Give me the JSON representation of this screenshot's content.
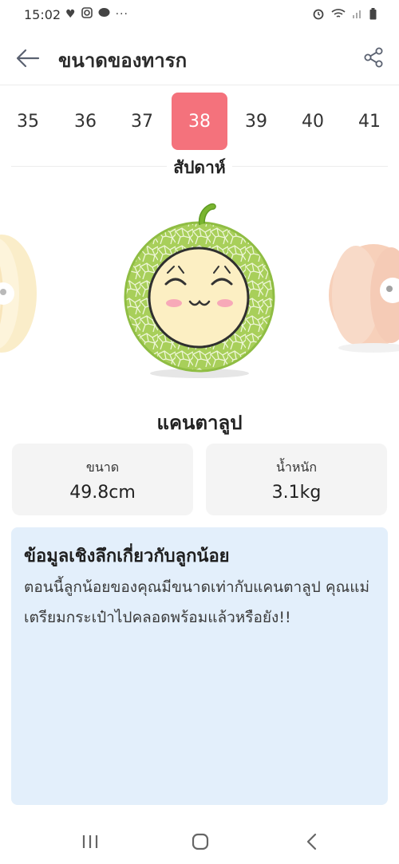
{
  "status_bar": {
    "time": "15:02"
  },
  "header": {
    "title": "ขนาดของทารก"
  },
  "weeks": {
    "items": [
      "35",
      "36",
      "37",
      "38",
      "39",
      "40",
      "41"
    ],
    "selected_index": 3,
    "label": "สัปดาห์"
  },
  "fruit": {
    "name": "แคนตาลูป"
  },
  "stats": {
    "size_label": "ขนาด",
    "size_value": "49.8cm",
    "weight_label": "น้ำหนัก",
    "weight_value": "3.1kg"
  },
  "info": {
    "title": "ข้อมูลเชิงลึกเกี่ยวกับลูกน้อย",
    "body": "ตอนนี้ลูกน้อยของคุณมีขนาดเท่ากับแคนตาลูป คุณแม่เตรียมกระเป๋าไปคลอดพร้อมแล้วหรือยัง!!"
  },
  "colors": {
    "accent": "#f4727c",
    "info_bg": "#e3effb",
    "stat_bg": "#f4f4f4"
  }
}
